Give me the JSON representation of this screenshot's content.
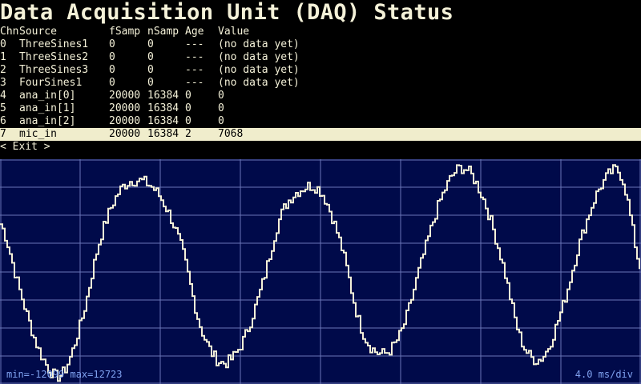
{
  "title": "Data Acquisition Unit (DAQ) Status",
  "table": {
    "headers": [
      "Chn",
      "Source",
      "fSamp",
      "nSamp",
      "Age",
      "Value"
    ],
    "rows": [
      [
        "0",
        "ThreeSines1",
        "0",
        "0",
        "---",
        "(no data yet)"
      ],
      [
        "1",
        "ThreeSines2",
        "0",
        "0",
        "---",
        "(no data yet)"
      ],
      [
        "2",
        "ThreeSines3",
        "0",
        "0",
        "---",
        "(no data yet)"
      ],
      [
        "3",
        "FourSines1",
        "0",
        "0",
        "---",
        "(no data yet)"
      ],
      [
        "4",
        "ana_in[0]",
        "20000",
        "16384",
        "0",
        "0"
      ],
      [
        "5",
        "ana_in[1]",
        "20000",
        "16384",
        "0",
        "0"
      ],
      [
        "6",
        "ana_in[2]",
        "20000",
        "16384",
        "0",
        "0"
      ],
      [
        "7",
        "mic_in",
        "20000",
        "16384",
        "2",
        "7068"
      ]
    ],
    "selected_index": 7
  },
  "exit_label": "< Exit >",
  "scope": {
    "min_max_label": "min=-12099 max=12723",
    "timebase_label": "4.0 ms/div",
    "colors": {
      "background": "#000a4a",
      "grid": "#6a74b8",
      "trace": "#f4f1d8",
      "labels": "#7fa2f0"
    }
  },
  "chart_data": {
    "type": "line",
    "title": "",
    "xlabel": "",
    "ylabel": "",
    "x_unit": "ms",
    "x_per_division_ms": 4.0,
    "x_divisions": 8,
    "y_divisions": 8,
    "ylim": [
      -13000,
      13000
    ],
    "grid": true,
    "series": [
      {
        "x": [
          0,
          1,
          2,
          3,
          4,
          5,
          6,
          7,
          8,
          9,
          10,
          11,
          12,
          13,
          14,
          15,
          16,
          17,
          18,
          19,
          20,
          21,
          22,
          23,
          24,
          25,
          26,
          27,
          28,
          29,
          30,
          31,
          32
        ],
        "y": [
          5500,
          -2500,
          -9500,
          -12000,
          -6000,
          4000,
          9500,
          10500,
          8500,
          3000,
          -6500,
          -10500,
          -8500,
          -2000,
          6500,
          9500,
          9200,
          3000,
          -6500,
          -9500,
          -7000,
          1000,
          8500,
          12000,
          9000,
          1500,
          -8000,
          -10000,
          -4500,
          4000,
          10000,
          11000,
          0
        ]
      }
    ]
  }
}
